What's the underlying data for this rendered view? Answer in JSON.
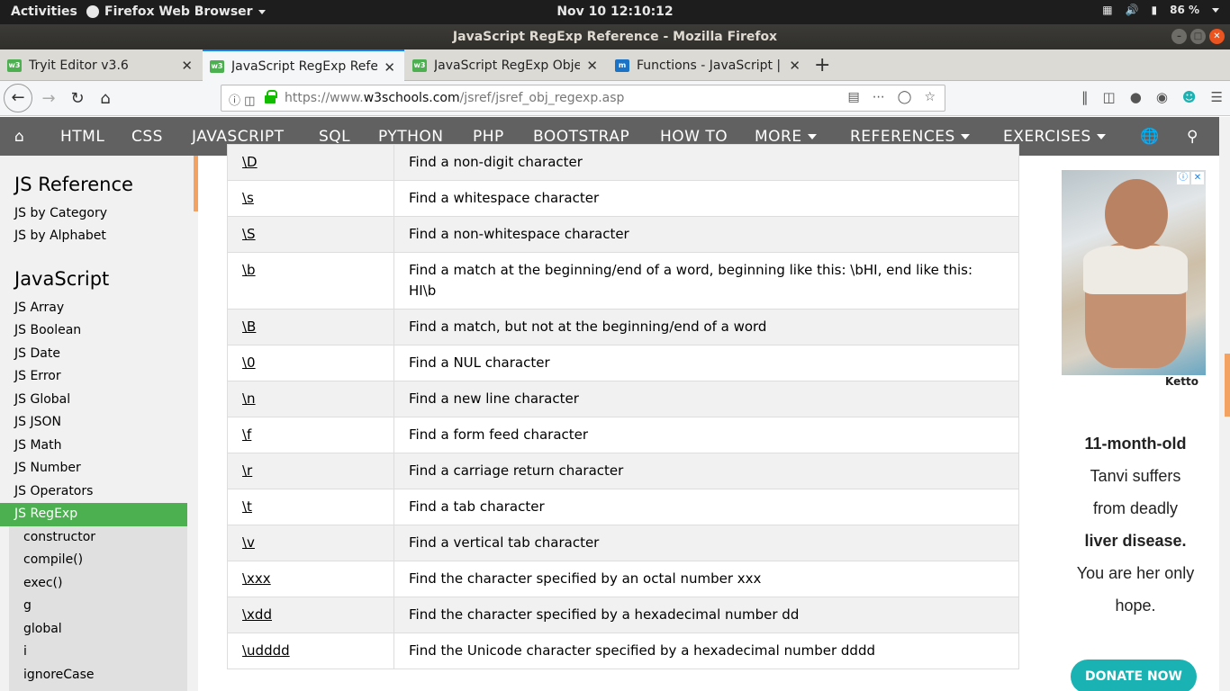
{
  "system_bar": {
    "activities": "Activities",
    "app_menu": "Firefox Web Browser",
    "clock": "Nov 10  12:10:12",
    "battery": "86 %"
  },
  "window": {
    "title": "JavaScript RegExp Reference - Mozilla Firefox"
  },
  "tabs": [
    {
      "label": "Tryit Editor v3.6",
      "favicon": "w3",
      "active": false
    },
    {
      "label": "JavaScript RegExp Refere",
      "favicon": "w3",
      "active": true
    },
    {
      "label": "JavaScript RegExp Obje",
      "favicon": "w3",
      "active": false
    },
    {
      "label": "Functions - JavaScript | M",
      "favicon": "mdn",
      "active": false
    }
  ],
  "url": {
    "prefix": "https://www.",
    "domain": "w3schools.com",
    "path": "/jsref/jsref_obj_regexp.asp"
  },
  "site_nav": {
    "items": [
      "HTML",
      "CSS",
      "JAVASCRIPT",
      "SQL",
      "PYTHON",
      "PHP",
      "BOOTSTRAP",
      "HOW TO"
    ],
    "dropdowns": [
      "MORE",
      "REFERENCES",
      "EXERCISES"
    ]
  },
  "sidebar": {
    "heading1": "JS Reference",
    "links1": [
      "JS by Category",
      "JS by Alphabet"
    ],
    "heading2": "JavaScript",
    "links2": [
      "JS Array",
      "JS Boolean",
      "JS Date",
      "JS Error",
      "JS Global",
      "JS JSON",
      "JS Math",
      "JS Number",
      "JS Operators"
    ],
    "active": "JS RegExp",
    "sub_links": [
      "constructor",
      "compile()",
      "exec()",
      "g",
      "global",
      "i",
      "ignoreCase"
    ]
  },
  "table": {
    "rows": [
      {
        "code": "\\D",
        "desc": "Find a non-digit character"
      },
      {
        "code": "\\s",
        "desc": "Find a whitespace character"
      },
      {
        "code": "\\S",
        "desc": "Find a non-whitespace character"
      },
      {
        "code": "\\b",
        "desc": "Find a match at the beginning/end of a word, beginning like this: \\bHI, end like this: HI\\b"
      },
      {
        "code": "\\B",
        "desc": "Find a match, but not at the beginning/end of a word"
      },
      {
        "code": "\\0",
        "desc": "Find a NUL character"
      },
      {
        "code": "\\n",
        "desc": "Find a new line character"
      },
      {
        "code": "\\f",
        "desc": "Find a form feed character"
      },
      {
        "code": "\\r",
        "desc": "Find a carriage return character"
      },
      {
        "code": "\\t",
        "desc": "Find a tab character"
      },
      {
        "code": "\\v",
        "desc": "Find a vertical tab character"
      },
      {
        "code": "\\xxx",
        "desc": "Find the character specified by an octal number xxx"
      },
      {
        "code": "\\xdd",
        "desc": "Find the character specified by a hexadecimal number dd"
      },
      {
        "code": "\\udddd",
        "desc": "Find the Unicode character specified by a hexadecimal number dddd"
      }
    ]
  },
  "ad": {
    "brand": "Ketto",
    "line1": "11-month-old",
    "line2": "Tanvi suffers",
    "line3": "from deadly",
    "line4": "liver disease.",
    "line5": "You are her only",
    "line6": "hope.",
    "button": "DONATE NOW"
  },
  "colors": {
    "w3_green": "#4caf50",
    "nav_gray": "#616161",
    "accent_orange": "#f4a261",
    "donate_teal": "#1ab2b2"
  }
}
